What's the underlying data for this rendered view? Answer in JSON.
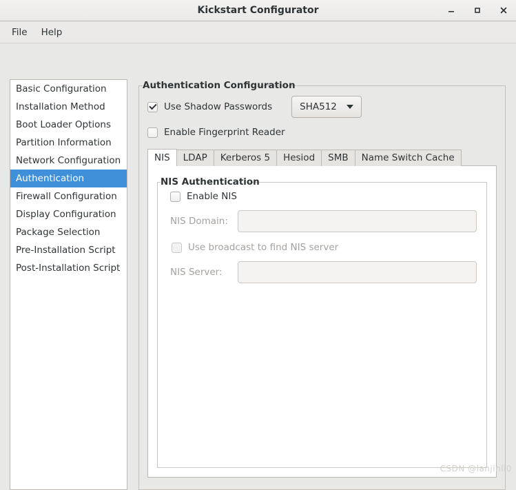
{
  "window": {
    "title": "Kickstart Configurator",
    "controls": [
      {
        "name": "minimize",
        "glyph": "minimize-icon"
      },
      {
        "name": "maximize",
        "glyph": "maximize-icon"
      },
      {
        "name": "close",
        "glyph": "close-icon"
      }
    ]
  },
  "menubar": {
    "items": [
      {
        "label": "File"
      },
      {
        "label": "Help"
      }
    ]
  },
  "sidebar": {
    "items": [
      {
        "label": "Basic Configuration",
        "selected": false
      },
      {
        "label": "Installation Method",
        "selected": false
      },
      {
        "label": "Boot Loader Options",
        "selected": false
      },
      {
        "label": "Partition Information",
        "selected": false
      },
      {
        "label": "Network Configuration",
        "selected": false
      },
      {
        "label": "Authentication",
        "selected": true
      },
      {
        "label": "Firewall Configuration",
        "selected": false
      },
      {
        "label": "Display Configuration",
        "selected": false
      },
      {
        "label": "Package Selection",
        "selected": false
      },
      {
        "label": "Pre-Installation Script",
        "selected": false
      },
      {
        "label": "Post-Installation Script",
        "selected": false
      }
    ]
  },
  "main": {
    "frame_title": "Authentication Configuration",
    "shadow_passwords": {
      "label": "Use Shadow Passwords",
      "checked": true
    },
    "hash_algorithm": {
      "value": "SHA512",
      "caret": "chevron-down-icon"
    },
    "fingerprint_reader": {
      "label": "Enable Fingerprint Reader",
      "checked": false
    },
    "tabs": [
      {
        "label": "NIS",
        "active": true
      },
      {
        "label": "LDAP",
        "active": false
      },
      {
        "label": "Kerberos 5",
        "active": false
      },
      {
        "label": "Hesiod",
        "active": false
      },
      {
        "label": "SMB",
        "active": false
      },
      {
        "label": "Name Switch Cache",
        "active": false
      }
    ],
    "nis_panel": {
      "title": "NIS Authentication",
      "enable_nis": {
        "label": "Enable NIS",
        "checked": false,
        "disabled": false
      },
      "nis_domain": {
        "label": "NIS Domain:",
        "value": "",
        "placeholder": "",
        "disabled": true
      },
      "use_broadcast": {
        "label": "Use broadcast to find NIS server",
        "checked": false,
        "disabled": true
      },
      "nis_server": {
        "label": "NIS Server:",
        "value": "",
        "placeholder": "",
        "disabled": true
      }
    }
  },
  "watermark": {
    "text": "CSDN @lanjinli0"
  },
  "colors": {
    "accent": "#3f8fd9",
    "window_bg": "#e8e8e6",
    "panel_bg": "#ffffff",
    "text": "#2e3436",
    "disabled_text": "#a5a19d"
  }
}
